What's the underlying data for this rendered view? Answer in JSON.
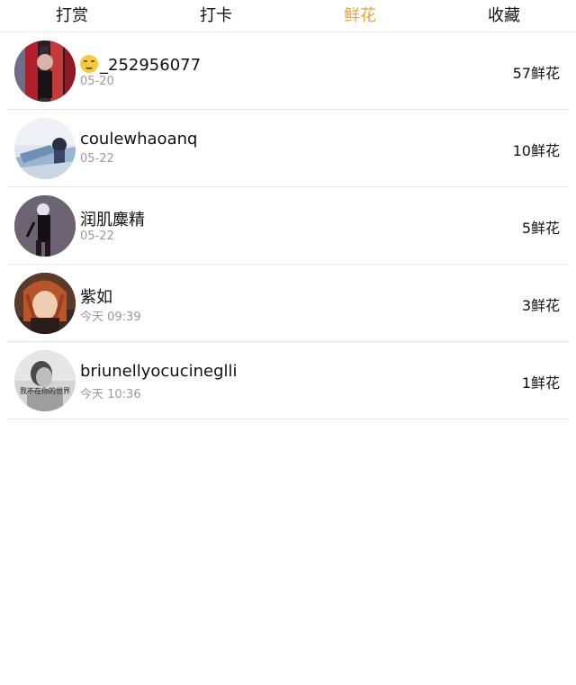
{
  "tabs": [
    {
      "label": "打赏",
      "active": false
    },
    {
      "label": "打卡",
      "active": false
    },
    {
      "label": "鲜花",
      "active": true
    },
    {
      "label": "收藏",
      "active": false
    }
  ],
  "accent_color": "#f0a336",
  "rows": [
    {
      "name": "_252956077",
      "emoji": "smirk-emoji",
      "time": "05-20",
      "flowers": "57鲜花"
    },
    {
      "name": "coulewhaoanq",
      "time": "05-22",
      "flowers": "10鲜花"
    },
    {
      "name": "润肌麋精",
      "time": "05-22",
      "flowers": "5鲜花"
    },
    {
      "name": "紫如",
      "time": "今天 09:39",
      "flowers": "3鲜花"
    },
    {
      "name": "briunellyocucineglli",
      "time": "今天 10:36",
      "flowers": "1鲜花",
      "avatar_text": "我不在你的世界"
    }
  ]
}
